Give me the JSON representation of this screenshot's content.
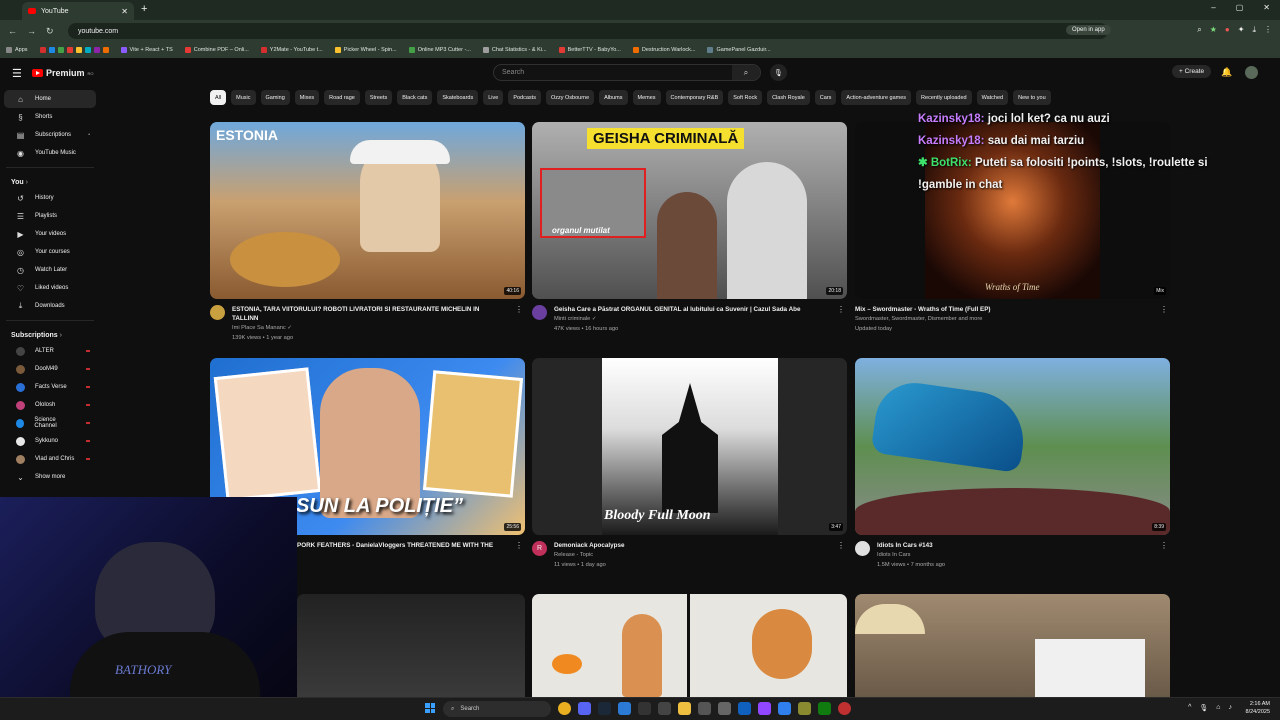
{
  "browser": {
    "tab_title": "YouTube",
    "url": "youtube.com",
    "open_in_app": "Open in app",
    "bookmarks": [
      {
        "label": "Apps",
        "color": "#888888"
      },
      {
        "label": "Vite + React + TS",
        "color": "#8a5cff"
      },
      {
        "label": "Combine PDF – Onli...",
        "color": "#e53935"
      },
      {
        "label": "Y2Mate - YouTube t...",
        "color": "#d32f2f"
      },
      {
        "label": "Picker Wheel - Spin...",
        "color": "#fbc02d"
      },
      {
        "label": "Online MP3 Cutter -...",
        "color": "#43a047"
      },
      {
        "label": "Chat Statistics - & Ki...",
        "color": "#9e9e9e"
      },
      {
        "label": "BetterTTV - BabyYo...",
        "color": "#e53935"
      },
      {
        "label": "Destruction Warlock...",
        "color": "#ef6c00"
      },
      {
        "label": "GamePanel Gazduir...",
        "color": "#607d8b"
      }
    ]
  },
  "header": {
    "logo_text": "Premium",
    "logo_sup": "RO",
    "search_placeholder": "Search",
    "create_label": "+ Create"
  },
  "sidebar": {
    "main": [
      {
        "label": "Home",
        "icon": "home-icon",
        "glyph": "⌂"
      },
      {
        "label": "Shorts",
        "icon": "shorts-icon",
        "glyph": "§"
      },
      {
        "label": "Subscriptions",
        "icon": "subscriptions-icon",
        "glyph": "▤"
      },
      {
        "label": "YouTube Music",
        "icon": "music-icon",
        "glyph": "◉"
      }
    ],
    "you_header": "You",
    "you": [
      {
        "label": "History",
        "icon": "history-icon",
        "glyph": "↺"
      },
      {
        "label": "Playlists",
        "icon": "playlists-icon",
        "glyph": "☰"
      },
      {
        "label": "Your videos",
        "icon": "your-videos-icon",
        "glyph": "▶"
      },
      {
        "label": "Your courses",
        "icon": "courses-icon",
        "glyph": "◎"
      },
      {
        "label": "Watch Later",
        "icon": "clock-icon",
        "glyph": "◷"
      },
      {
        "label": "Liked videos",
        "icon": "like-icon",
        "glyph": "👍"
      },
      {
        "label": "Downloads",
        "icon": "download-icon",
        "glyph": "⤓"
      }
    ],
    "subs_header": "Subscriptions",
    "subs": [
      {
        "label": "ALTER",
        "color": "#444444"
      },
      {
        "label": "DooM49",
        "color": "#7a5a3a"
      },
      {
        "label": "Facts Verse",
        "color": "#2a6fd6"
      },
      {
        "label": "Ololosh",
        "color": "#c0407a"
      },
      {
        "label": "Science Channel",
        "color": "#1e88e5"
      },
      {
        "label": "Sykkuno",
        "color": "#e8e8e8"
      },
      {
        "label": "Vlad and Chris",
        "color": "#a08060"
      }
    ],
    "show_more": "Show more"
  },
  "chips": [
    "All",
    "Music",
    "Gaming",
    "Mixes",
    "Road rage",
    "Streets",
    "Black cats",
    "Skateboards",
    "Live",
    "Podcasts",
    "Ozzy Osbourne",
    "Albums",
    "Memes",
    "Contemporary R&B",
    "Soft Rock",
    "Clash Royale",
    "Cars",
    "Action-adventure games",
    "Recently uploaded",
    "Watched",
    "New to you"
  ],
  "videos": [
    {
      "title": "ESTONIA, TARA VIITORULUI? ROBOTI LIVRATORI SI RESTAURANTE MICHELIN IN TALLINN",
      "channel": "Imi Place Sa Mananc ✓",
      "stats": "139K views • 1 year ago",
      "duration": "40:16",
      "overlay": "ESTONIA",
      "color": "#3a7bd5"
    },
    {
      "title": "Geisha Care a Păstrat ORGANUL GENITAL al Iubitului ca Suvenir | Cazul Sada Abe",
      "channel": "Minti criminale ✓",
      "stats": "47K views • 16 hours ago",
      "duration": "20:18",
      "overlay": "GEISHA CRIMINALĂ",
      "overlay2": "organul mutilat",
      "color": "#6a6a6a"
    },
    {
      "title": "Mix – Swordmaster - Wraths of Time (Full EP)",
      "channel": "Swordmaster, Swordmaster, Dismember and more",
      "stats": "Updated today",
      "duration": "Mix",
      "overlay": "Wraths of Time",
      "color": "#3a1f10"
    },
    {
      "title": "PORK FEATHERS - DanielaVloggers THREATENED ME WITH THE",
      "channel": "",
      "stats": "",
      "duration": "25:56",
      "overlay": "SUN LA POLIȚIE”",
      "color": "#1a4fa0"
    },
    {
      "title": "Demoniack Apocalypse",
      "channel": "Release - Topic",
      "stats": "11 views • 1 day ago",
      "duration": "3:47",
      "overlay": "Bloody Full Moon",
      "color": "#262626"
    },
    {
      "title": "Idiots In Cars #143",
      "channel": "Idiots In Cars",
      "stats": "1.5M views • 7 months ago",
      "duration": "8:39",
      "overlay": "",
      "color": "#5f8a58"
    }
  ],
  "chat": [
    {
      "user": "Kazinsky18:",
      "msg": "joci lol ket? ca nu auzi"
    },
    {
      "user": "Kazinsky18:",
      "msg": "sau dai mai tarziu"
    },
    {
      "user": "BotRix:",
      "msg": "Puteti sa folositi !points, !slots, !roulette si !gamble in chat"
    }
  ],
  "taskbar": {
    "search_placeholder": "Search",
    "time": "2:16 AM",
    "date": "8/24/2025"
  }
}
